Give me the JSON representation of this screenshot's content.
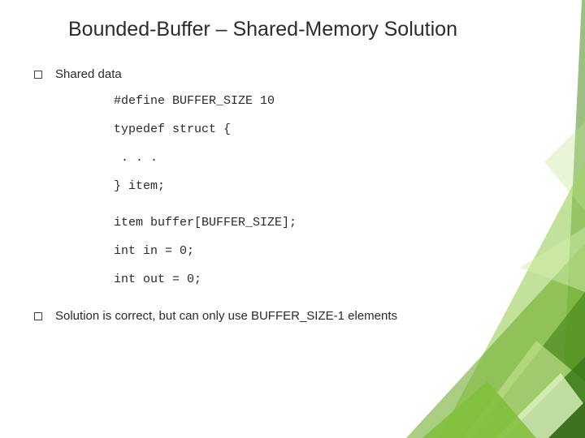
{
  "title": "Bounded-Buffer – Shared-Memory Solution",
  "bullets": {
    "b1": "Shared data",
    "b2": "Solution is correct, but can only use BUFFER_SIZE-1 elements"
  },
  "code": {
    "l1": "#define BUFFER_SIZE 10",
    "l2": "typedef struct {",
    "l3": " . . .",
    "l4": "} item;",
    "l5": "item buffer[BUFFER_SIZE];",
    "l6": "int in = 0;",
    "l7": "int out = 0;"
  },
  "colors": {
    "accent_dark": "#3a7a1a",
    "accent_mid": "#6fae2e",
    "accent_light": "#a6d870"
  }
}
